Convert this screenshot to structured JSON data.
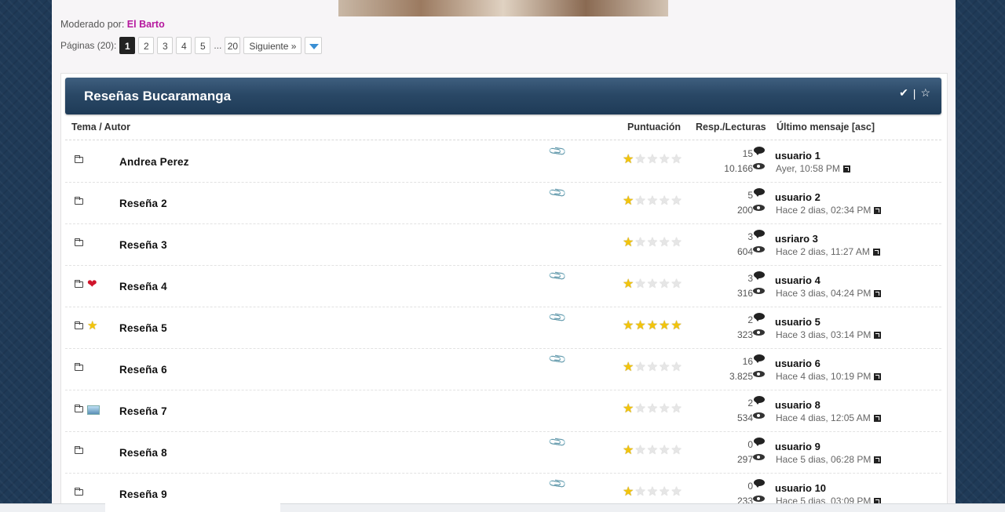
{
  "moderation": {
    "label": "Moderado por:",
    "moderator": "El Barto"
  },
  "pagination": {
    "label": "Páginas (20):",
    "pages": [
      "1",
      "2",
      "3",
      "4",
      "5"
    ],
    "ellipsis": "...",
    "last": "20",
    "next": "Siguiente »",
    "current": "1"
  },
  "forum": {
    "title": "Reseñas Bucaramanga",
    "tools": {
      "mark_read_icon": "check-icon",
      "separator": "|",
      "subscribe_icon": "star-outline-icon"
    },
    "columns": {
      "topic": "Tema / Autor",
      "rating": "Puntuación",
      "replies_views": "Resp./Lecturas",
      "last_post": "Último mensaje [asc]"
    },
    "topics": [
      {
        "title": "Andrea Perez",
        "status_icon": "",
        "attachment": true,
        "rating": 1,
        "replies": "15",
        "views": "10.166",
        "last_user": "usuario 1",
        "last_date": "Ayer, 10:58 PM"
      },
      {
        "title": "Reseña 2",
        "status_icon": "",
        "attachment": true,
        "rating": 1,
        "replies": "5",
        "views": "200",
        "last_user": "usuario 2",
        "last_date": "Hace 2 dias, 02:34 PM"
      },
      {
        "title": "Reseña 3",
        "status_icon": "",
        "attachment": false,
        "rating": 1,
        "replies": "3",
        "views": "604",
        "last_user": "usriaro 3",
        "last_date": "Hace 2 dias, 11:27 AM"
      },
      {
        "title": "Reseña 4",
        "status_icon": "heart-icon",
        "attachment": true,
        "rating": 1,
        "replies": "3",
        "views": "316",
        "last_user": "usuario 4",
        "last_date": "Hace 3 dias, 04:24 PM"
      },
      {
        "title": "Reseña 5",
        "status_icon": "star-icon",
        "attachment": true,
        "rating": 5,
        "replies": "2",
        "views": "323",
        "last_user": "usuario 5",
        "last_date": "Hace 3 dias, 03:14 PM"
      },
      {
        "title": "Reseña 6",
        "status_icon": "",
        "attachment": true,
        "rating": 1,
        "replies": "16",
        "views": "3.825",
        "last_user": "usuario 6",
        "last_date": "Hace 4 dias, 10:19 PM"
      },
      {
        "title": "Reseña 7",
        "status_icon": "image-icon",
        "attachment": false,
        "rating": 1,
        "replies": "2",
        "views": "534",
        "last_user": "usuario 8",
        "last_date": "Hace 4 dias, 12:05 AM"
      },
      {
        "title": "Reseña 8",
        "status_icon": "",
        "attachment": true,
        "rating": 1,
        "replies": "0",
        "views": "297",
        "last_user": "usuario 9",
        "last_date": "Hace 5 dias, 06:28 PM"
      },
      {
        "title": "Reseña 9",
        "status_icon": "",
        "attachment": true,
        "rating": 1,
        "replies": "0",
        "views": "233",
        "last_user": "usuario 10",
        "last_date": "Hace 5 dias, 03:09 PM"
      }
    ]
  }
}
